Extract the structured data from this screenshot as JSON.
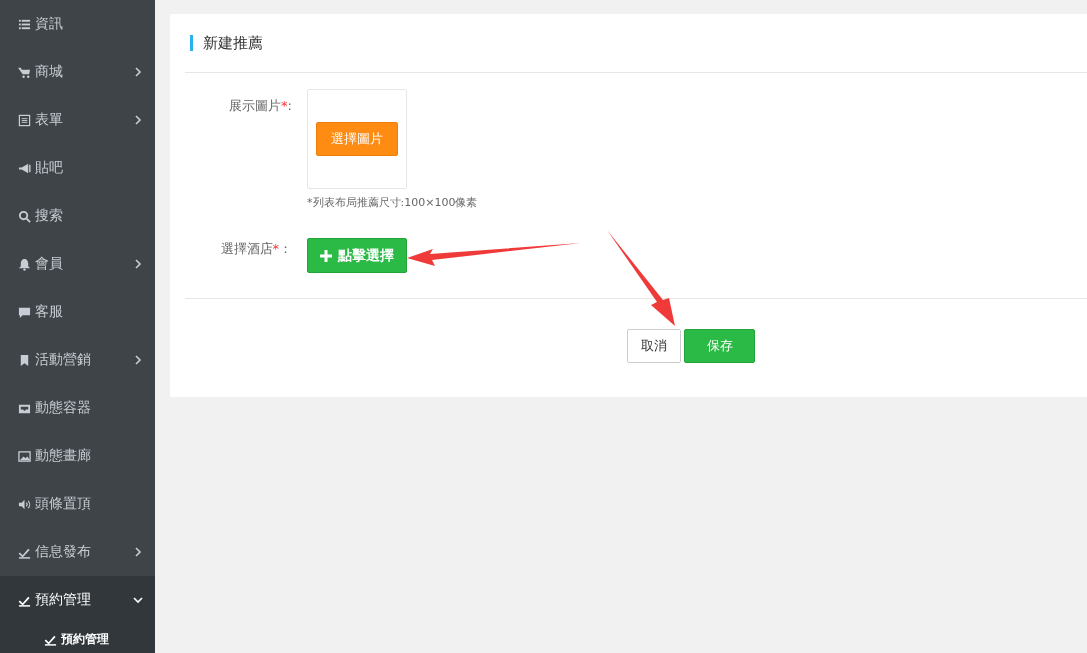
{
  "sidebar": {
    "items": [
      {
        "label": "資訊"
      },
      {
        "label": "商城",
        "expanded": false
      },
      {
        "label": "表單",
        "expanded": false
      },
      {
        "label": "貼吧"
      },
      {
        "label": "搜索"
      },
      {
        "label": "會員",
        "expanded": false
      },
      {
        "label": "客服"
      },
      {
        "label": "活動營銷",
        "expanded": false
      },
      {
        "label": "動態容器"
      },
      {
        "label": "動態畫廊"
      },
      {
        "label": "頭條置頂"
      },
      {
        "label": "信息發布",
        "expanded": false
      },
      {
        "label": "預約管理",
        "expanded": true,
        "children": [
          {
            "label": "預約管理"
          }
        ]
      }
    ]
  },
  "panel": {
    "title": "新建推薦",
    "image_field": {
      "label": "展示圖片",
      "mark": "*",
      "colon": ":",
      "button": "選擇圖片",
      "hint": "*列表布局推薦尺寸:100×100像素"
    },
    "hotel_field": {
      "label": "選擇酒店",
      "mark": "*",
      "colon": "：",
      "button": "點擊選擇"
    },
    "buttons": [
      {
        "kind": "cancel",
        "label": "取消"
      },
      {
        "kind": "save",
        "label": "保存"
      }
    ]
  }
}
